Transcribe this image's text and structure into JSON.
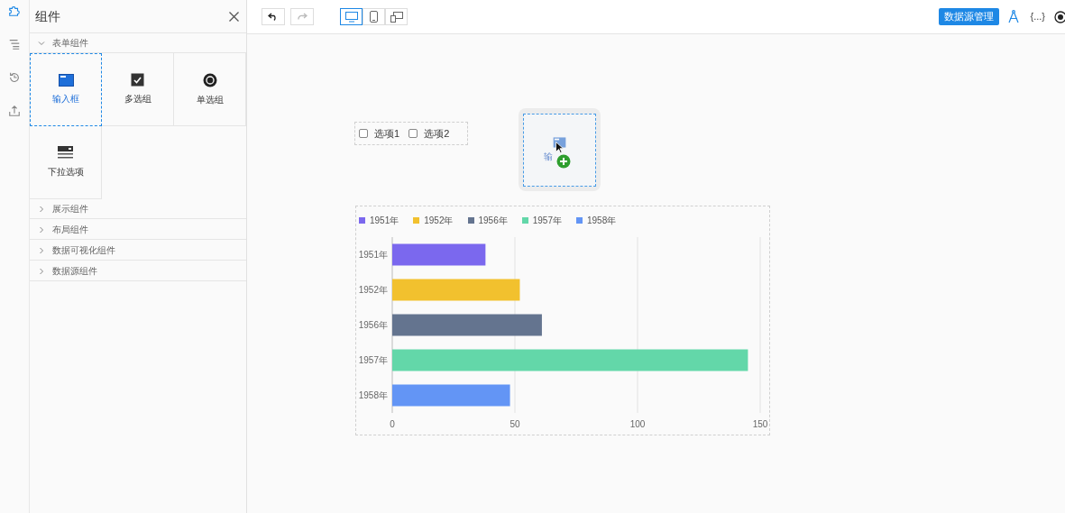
{
  "rail": [
    {
      "kind": "puzzle",
      "selected": true
    },
    {
      "kind": "outline",
      "selected": false
    },
    {
      "kind": "history",
      "selected": false
    },
    {
      "kind": "upload",
      "selected": false
    }
  ],
  "panel": {
    "title": "组件",
    "sections": [
      {
        "label": "表单组件",
        "expanded": true,
        "items": [
          {
            "label": "输入框",
            "kind": "input",
            "selected": true
          },
          {
            "label": "多选组",
            "kind": "checkbox",
            "selected": false
          },
          {
            "label": "单选组",
            "kind": "radio",
            "selected": false
          },
          {
            "label": "下拉选项",
            "kind": "select",
            "selected": false
          }
        ]
      },
      {
        "label": "展示组件",
        "expanded": false
      },
      {
        "label": "布局组件",
        "expanded": false
      },
      {
        "label": "数据可视化组件",
        "expanded": false
      },
      {
        "label": "数据源组件",
        "expanded": false
      }
    ]
  },
  "toolbar": {
    "undo_disabled": false,
    "redo_disabled": true,
    "devices": [
      {
        "kind": "desktop",
        "selected": true
      },
      {
        "kind": "mobile",
        "selected": false
      },
      {
        "kind": "tablet",
        "selected": false
      }
    ],
    "datasource_button": "数据源管理",
    "code_button": "{...}"
  },
  "canvas": {
    "checkbox_group": [
      {
        "label": "选项1",
        "checked": false
      },
      {
        "label": "选项2",
        "checked": false
      }
    ],
    "drag_ghost": {
      "label": "输"
    },
    "chart": {
      "chart_data": {
        "type": "bar",
        "orientation": "horizontal",
        "stacked": true,
        "legend": "top",
        "categories": [
          "1951年",
          "1952年",
          "1956年",
          "1957年",
          "1958年"
        ],
        "xlim": [
          0,
          150
        ],
        "xticks": [
          0,
          50,
          100,
          150
        ],
        "series": [
          {
            "name": "1951年",
            "color": "#7b68ee",
            "values": [
              38,
              null,
              null,
              null,
              null
            ]
          },
          {
            "name": "1952年",
            "color": "#f2c12e",
            "values": [
              null,
              52,
              null,
              null,
              null
            ]
          },
          {
            "name": "1956年",
            "color": "#64748f",
            "values": [
              null,
              null,
              61,
              null,
              null
            ]
          },
          {
            "name": "1957年",
            "color": "#63d7a9",
            "values": [
              null,
              null,
              null,
              145,
              null
            ]
          },
          {
            "name": "1958年",
            "color": "#6395f5",
            "values": [
              null,
              null,
              null,
              null,
              48
            ]
          }
        ]
      }
    }
  }
}
